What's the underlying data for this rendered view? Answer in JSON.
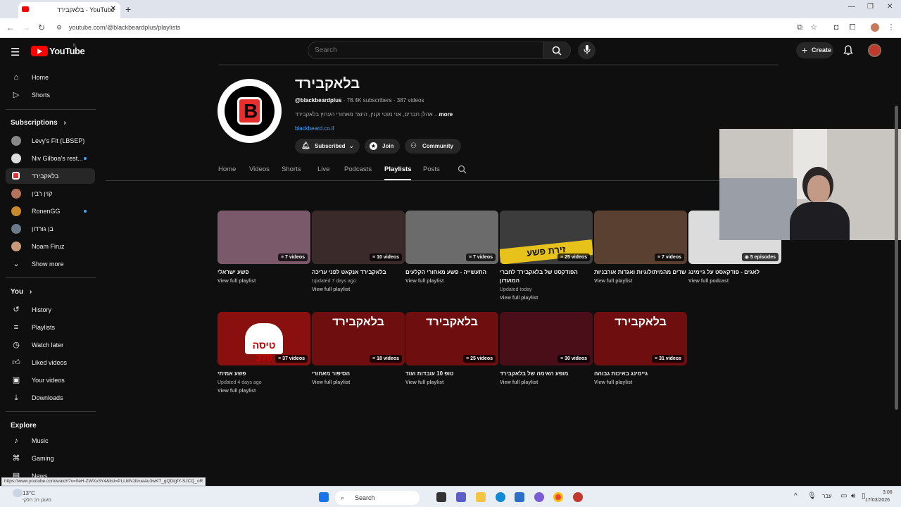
{
  "browser": {
    "tab_title": "בלאקבירד - YouTube",
    "tab_close": "✕",
    "new_tab": "+",
    "url": "youtube.com/@blackbeardplus/playlists",
    "status_link": "https://www.youtube.com/watch?v=0eH-ZWXv3Y4&list=PLLhlN1ltrueAu3wKT_gQDlgfY-SJCQ_oR"
  },
  "header": {
    "logo_text": "YouTube",
    "region": "IL",
    "search_placeholder": "Search",
    "create_label": "Create"
  },
  "sidebar": {
    "main": [
      {
        "label": "Home",
        "icon": "home-icon"
      },
      {
        "label": "Shorts",
        "icon": "shorts-icon"
      }
    ],
    "subscriptions_title": "Subscriptions",
    "subscriptions": [
      {
        "label": "Levy's Fit (LBSEP)",
        "dot": false
      },
      {
        "label": "Niv Gilboa's rest...",
        "dot": true
      },
      {
        "label": "בלאקבירד",
        "dot": false
      },
      {
        "label": "קוין רבין",
        "dot": false
      },
      {
        "label": "RonenGG",
        "dot": true
      },
      {
        "label": "בן גורדון",
        "dot": false
      },
      {
        "label": "Noam Firuz",
        "dot": false
      }
    ],
    "show_more": "Show more",
    "you_title": "You",
    "you_items": [
      {
        "label": "History",
        "icon": "history-icon"
      },
      {
        "label": "Playlists",
        "icon": "playlists-icon"
      },
      {
        "label": "Watch later",
        "icon": "watch-later-icon"
      },
      {
        "label": "Liked videos",
        "icon": "liked-icon"
      },
      {
        "label": "Your videos",
        "icon": "your-videos-icon"
      },
      {
        "label": "Downloads",
        "icon": "downloads-icon"
      }
    ],
    "explore_title": "Explore",
    "explore_items": [
      {
        "label": "Music",
        "icon": "music-icon"
      },
      {
        "label": "Gaming",
        "icon": "gaming-icon"
      },
      {
        "label": "News",
        "icon": "news-icon"
      }
    ]
  },
  "channel": {
    "name": "בלאקבירד",
    "handle": "@blackbeardplus",
    "meta": " · 78.4K subscribers · 387 videos",
    "description": "אהלן חברים, אני מוטי וקנין, היוצר מאחורי הערוץ בלאקבירד ...",
    "more": "more",
    "link": "blackbeard.co.il",
    "subscribed_label": "Subscribed",
    "join_label": "Join",
    "community_label": "Community",
    "tabs": [
      "Home",
      "Videos",
      "Shorts",
      "Live",
      "Podcasts",
      "Playlists",
      "Posts"
    ],
    "selected_tab": "Playlists"
  },
  "playlists": [
    {
      "title": "פשע ישראלי",
      "updated": "",
      "count": "7 videos",
      "view": "View full playlist",
      "color": "#7a5a6a",
      "thumb_text": ""
    },
    {
      "title": "בלאקבירד אנקאט לפני עריכה",
      "updated": "Updated 7 days ago",
      "count": "10 videos",
      "view": "View full playlist",
      "color": "#3a2a2a",
      "thumb_text": ""
    },
    {
      "title": "התעשייה - פשע מאחורי הקלעים",
      "updated": "",
      "count": "7 videos",
      "view": "View full playlist",
      "color": "#6b6b6b",
      "thumb_text": ""
    },
    {
      "title": "הפודקסט של בלאקבירד לחברי המועדון",
      "updated": "Updated today",
      "count": "25 videos",
      "view": "View full playlist",
      "color": "#3c3c3c",
      "thumb_text": "זירת פשע"
    },
    {
      "title": "שדים מהמיתולוגיות ואגדות אורבניות",
      "updated": "",
      "count": "7 videos",
      "view": "View full playlist",
      "color": "#5a4030",
      "thumb_text": ""
    },
    {
      "title": "לאגים - פודקאסט על גיימינג",
      "updated": "",
      "count": "5 episodes",
      "view": "View full podcast",
      "color": "#dcdcdc",
      "thumb_text": ""
    },
    {
      "title": "פשע אמיתי",
      "updated": "Updated 4 days ago",
      "count": "37 videos",
      "view": "View full playlist",
      "color": "#8a1010",
      "thumb_text": "טיסה 370"
    },
    {
      "title": "הסיפור מאחורי",
      "updated": "",
      "count": "18 videos",
      "view": "View full playlist",
      "color": "#6e0e0e",
      "thumb_text": "בלאקבירד"
    },
    {
      "title": "טופ 10 עובדות ועוד",
      "updated": "",
      "count": "25 videos",
      "view": "View full playlist",
      "color": "#6e0e0e",
      "thumb_text": "בלאקבירד"
    },
    {
      "title": "מופע האימה של בלאקבירד",
      "updated": "",
      "count": "30 videos",
      "view": "View full playlist",
      "color": "#4a0e18",
      "thumb_text": ""
    },
    {
      "title": "גיימינג באיכות גבוהה",
      "updated": "",
      "count": "31 videos",
      "view": "View full playlist",
      "color": "#6e0e0e",
      "thumb_text": "בלאקבירד"
    }
  ],
  "taskbar": {
    "weather_temp": "13°C",
    "weather_desc": "מעונן רב חלקי",
    "search_label": "Search",
    "lang": "עבר",
    "time": "3:06",
    "date": "17/03/2026"
  }
}
